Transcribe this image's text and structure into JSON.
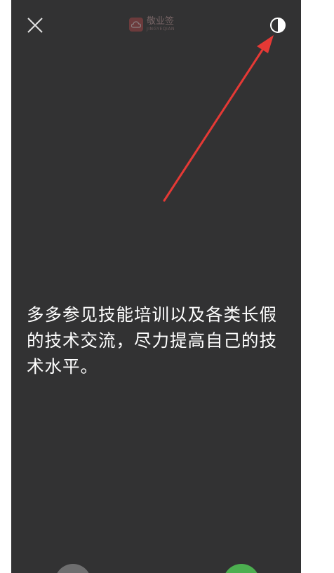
{
  "header": {
    "close_icon": "close-icon",
    "logo_name": "敬业签",
    "logo_sub": "JINGYEQIAN",
    "contrast_icon": "contrast-icon"
  },
  "main": {
    "text": "多多参见技能培训以及各类长假的技术交流，尽力提高自己的技术水平。"
  },
  "annotation": {
    "arrow_color": "#e53935"
  },
  "footer": {
    "left_button_color": "#6e6e6f",
    "right_button_color": "#4caf50"
  },
  "colors": {
    "background": "#323233",
    "text": "#ffffff"
  }
}
